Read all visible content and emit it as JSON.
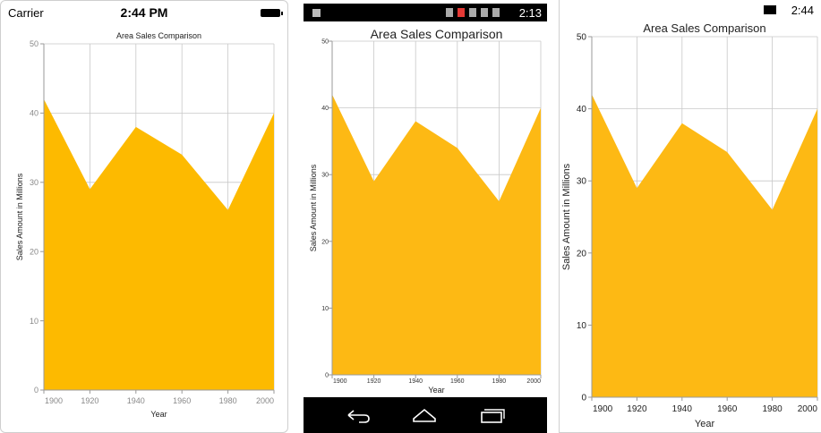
{
  "devices": {
    "ios": {
      "carrier": "Carrier",
      "time": "2:44 PM"
    },
    "android": {
      "time": "2:13"
    },
    "windows": {
      "time": "2:44"
    }
  },
  "colors": {
    "area_ios": "#FDBA00",
    "area_android": "#FDB914",
    "area_windows": "#FDB914",
    "grid": "#c8c8c8",
    "axis": "#9a9a9a"
  },
  "chart_data": {
    "type": "area",
    "title": "Area Sales Comparison",
    "xlabel": "Year",
    "ylabel": "Sales Amount in Millions",
    "x": [
      1900,
      1920,
      1940,
      1960,
      1980,
      2000
    ],
    "series": [
      {
        "values": [
          42,
          29,
          38,
          34,
          26,
          40
        ]
      }
    ],
    "xlim": [
      1900,
      2000
    ],
    "ylim": [
      0,
      50
    ],
    "x_ticks": [
      "1900",
      "1920",
      "1940",
      "1960",
      "1980",
      "2000"
    ],
    "y_ticks": [
      "0",
      "10",
      "20",
      "30",
      "40",
      "50"
    ],
    "grid": true,
    "legend": "none"
  }
}
